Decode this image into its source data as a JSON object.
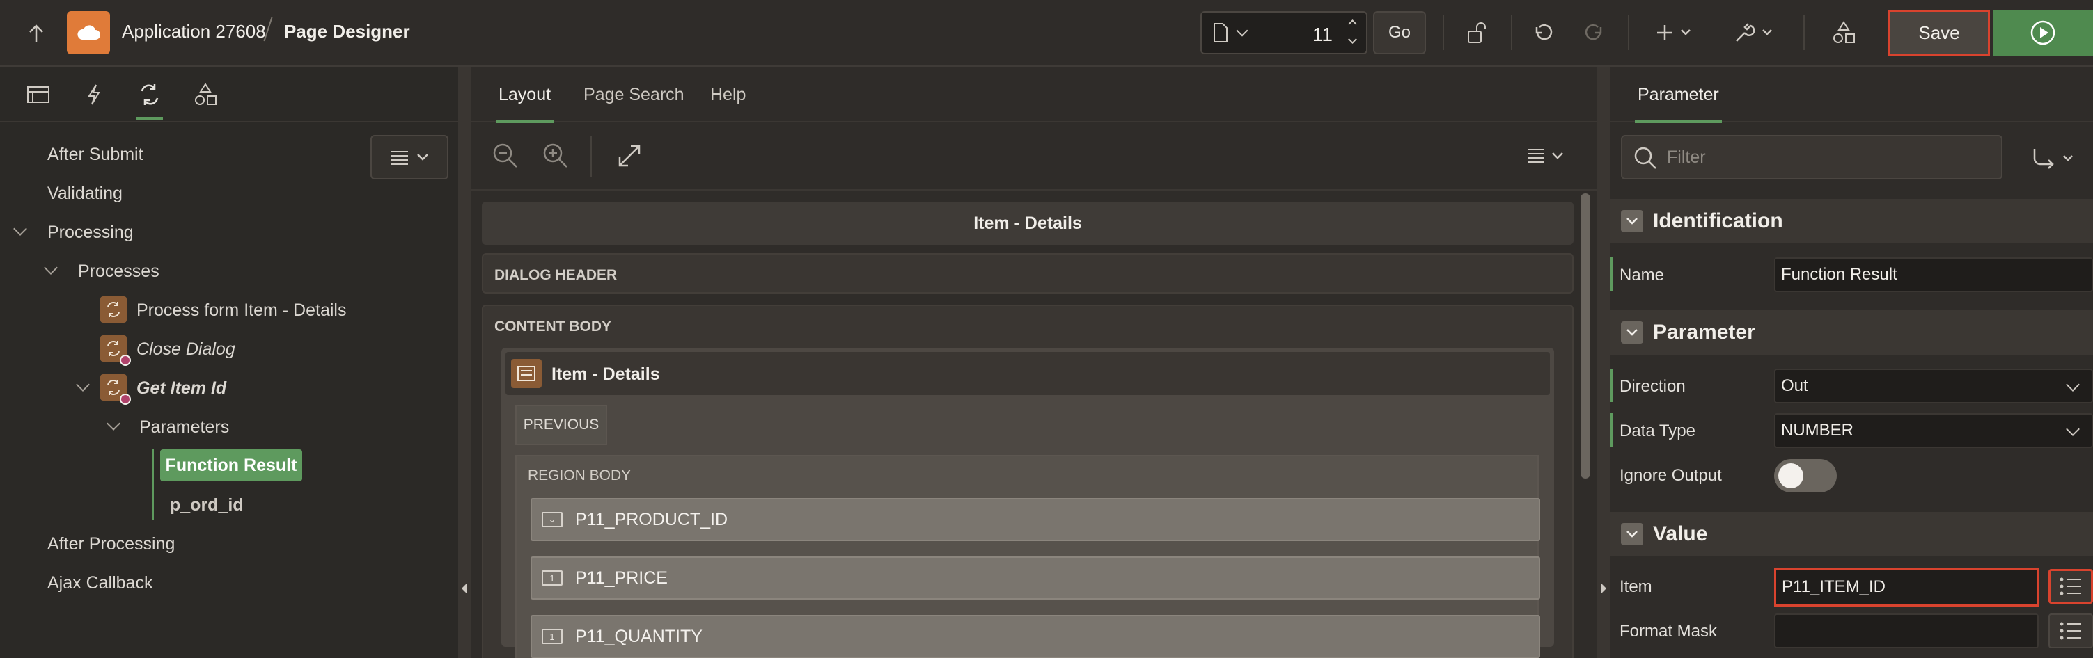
{
  "header": {
    "app_title": "Application 27608",
    "page_label": "Page Designer",
    "page_number": "11",
    "go_label": "Go",
    "save_label": "Save"
  },
  "left": {
    "tree": [
      {
        "label": "After Submit"
      },
      {
        "label": "Validating"
      },
      {
        "label": "Processing"
      },
      {
        "label": "Processes"
      },
      {
        "label": "Process form Item - Details"
      },
      {
        "label": "Close Dialog"
      },
      {
        "label": "Get Item Id"
      },
      {
        "label": "Parameters"
      },
      {
        "label": "Function Result"
      },
      {
        "label": "p_ord_id"
      },
      {
        "label": "After Processing"
      },
      {
        "label": "Ajax Callback"
      }
    ]
  },
  "middle": {
    "tabs": [
      "Layout",
      "Page Search",
      "Help"
    ],
    "dialog_title": "Item - Details",
    "dialog_header_label": "DIALOG HEADER",
    "content_body_label": "CONTENT BODY",
    "region_title": "Item - Details",
    "previous_label": "PREVIOUS",
    "region_body_label": "REGION BODY",
    "fields": [
      {
        "name": "P11_PRODUCT_ID",
        "icon": "select-list-icon"
      },
      {
        "name": "P11_PRICE",
        "icon": "number-field-icon"
      },
      {
        "name": "P11_QUANTITY",
        "icon": "number-field-icon"
      }
    ]
  },
  "right": {
    "tab": "Parameter",
    "filter_placeholder": "Filter",
    "sections": {
      "identification": "Identification",
      "parameter": "Parameter",
      "value": "Value"
    },
    "props": {
      "name_label": "Name",
      "name_value": "Function Result",
      "direction_label": "Direction",
      "direction_value": "Out",
      "datatype_label": "Data Type",
      "datatype_value": "NUMBER",
      "ignore_label": "Ignore Output",
      "item_label": "Item",
      "item_value": "P11_ITEM_ID",
      "format_label": "Format Mask",
      "format_value": ""
    }
  },
  "colors": {
    "accent_green": "#5e9a5e",
    "highlight_red": "#d9432e",
    "app_orange": "#e07b39"
  }
}
